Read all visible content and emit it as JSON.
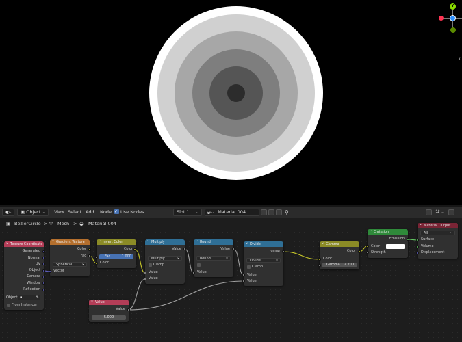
{
  "colors": {
    "input_header": "#b43d57",
    "texture_header": "#b46f2d",
    "color_header": "#8b8b26",
    "converter_header": "#2f6f96",
    "shader_header": "#2f8a3a",
    "output_header": "#7a2435",
    "accent": "#4772b3"
  },
  "viewport": {
    "rings": [
      "#ffffff",
      "#d0d0d0",
      "#a7a7a7",
      "#7e7e7e",
      "#555555",
      "#2c2c2c",
      "#000000"
    ],
    "gizmo": {
      "y_label": "Y",
      "z_label": "Z"
    }
  },
  "header": {
    "editor_icon": "node-editor-icon",
    "object_type": "Object",
    "menus": [
      "View",
      "Select",
      "Add",
      "Node"
    ],
    "use_nodes_label": "Use Nodes",
    "slot": "Slot 1",
    "material": "Material.004"
  },
  "breadcrumb": {
    "object": "BezierCircle",
    "mesh": "Mesh",
    "material": "Material.004",
    "separator": ">"
  },
  "nodes": {
    "texcoord": {
      "title": "Texture Coordinate",
      "outputs": [
        "Generated",
        "Normal",
        "UV",
        "Object",
        "Camera",
        "Window",
        "Reflection"
      ],
      "object_label": "Object:",
      "from_instancer": "From Instancer"
    },
    "gradient": {
      "title": "Gradient Texture",
      "outputs": [
        "Color",
        "Fac"
      ],
      "type": "Spherical",
      "input": "Vector"
    },
    "invert": {
      "title": "Invert Color",
      "output": "Color",
      "fac_label": "Fac",
      "fac_value": "1.000",
      "input": "Color"
    },
    "multiply": {
      "title": "Multiply",
      "output": "Value",
      "operation": "Multiply",
      "clamp": "Clamp",
      "inputs": [
        "Value",
        "Value"
      ]
    },
    "round": {
      "title": "Round",
      "output": "Value",
      "operation": "Round",
      "input": "Value"
    },
    "divide": {
      "title": "Divide",
      "output": "Value",
      "operation": "Divide",
      "clamp": "Clamp",
      "inputs": [
        "Value",
        "Value"
      ]
    },
    "gamma": {
      "title": "Gamma",
      "output": "Color",
      "input": "Color",
      "gamma_label": "Gamma",
      "gamma_value": "2.200"
    },
    "emission": {
      "title": "Emission",
      "output": "Emission",
      "inputs": [
        "Color",
        "Strength"
      ]
    },
    "output": {
      "title": "Material Output",
      "target": "All",
      "inputs": [
        "Surface",
        "Volume",
        "Displacement"
      ]
    },
    "value": {
      "title": "Value",
      "output": "Value",
      "value": "5.000"
    }
  }
}
